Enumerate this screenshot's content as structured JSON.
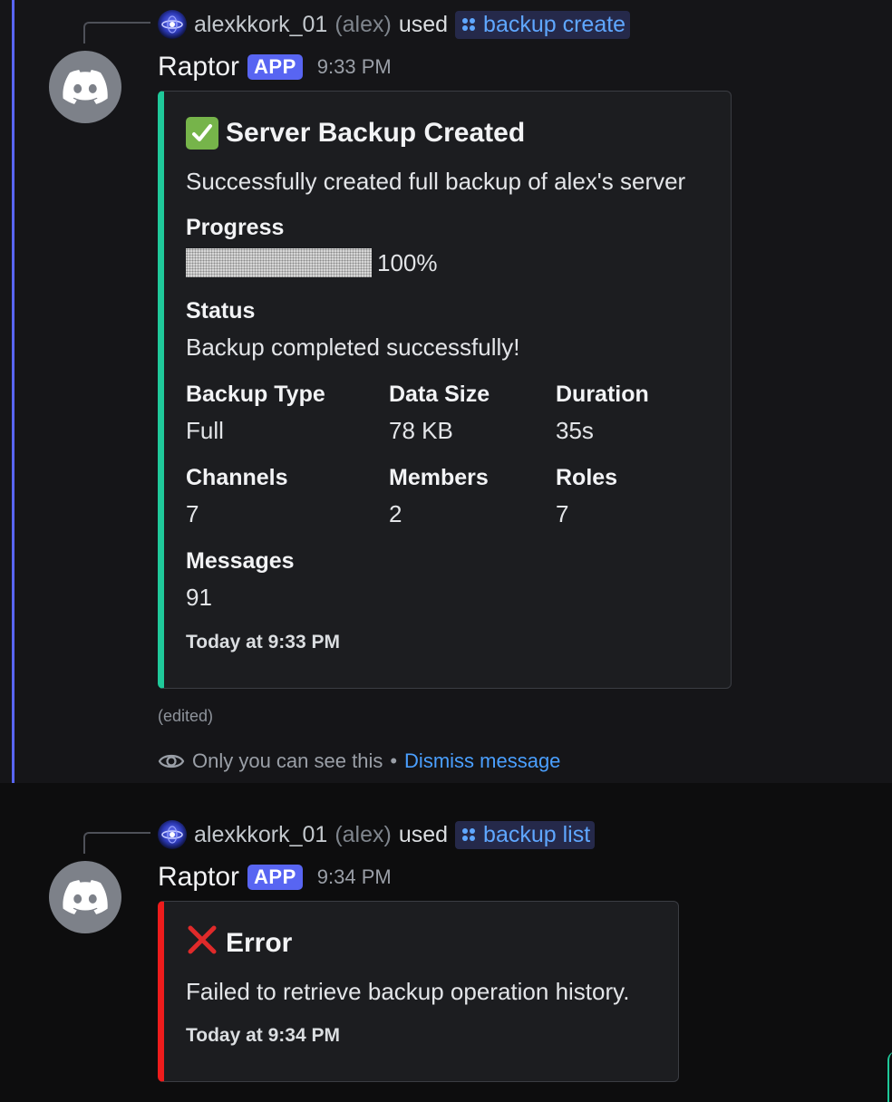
{
  "messages": [
    {
      "reply": {
        "user": "alexkkork_01",
        "nick": "(alex)",
        "used": "used",
        "command": "backup create"
      },
      "bot": {
        "name": "Raptor",
        "badge": "APP",
        "time": "9:33 PM"
      },
      "embed": {
        "accent": "#1fc99a",
        "icon": "check-mark-icon",
        "title": "Server Backup Created",
        "description": "Successfully created full backup of alex's server",
        "progress": {
          "label": "Progress",
          "percent": 100,
          "text": "100%"
        },
        "status": {
          "label": "Status",
          "value": "Backup completed successfully!"
        },
        "fields": [
          {
            "name": "Backup Type",
            "value": "Full"
          },
          {
            "name": "Data Size",
            "value": "78 KB"
          },
          {
            "name": "Duration",
            "value": "35s"
          },
          {
            "name": "Channels",
            "value": "7"
          },
          {
            "name": "Members",
            "value": "2"
          },
          {
            "name": "Roles",
            "value": "7"
          },
          {
            "name": "Messages",
            "value": "91"
          }
        ],
        "footer": "Today at 9:33 PM"
      },
      "edited": "(edited)",
      "ephemeral": {
        "notice": "Only you can see this",
        "separator": "•",
        "dismiss": "Dismiss message"
      }
    },
    {
      "reply": {
        "user": "alexkkork_01",
        "nick": "(alex)",
        "used": "used",
        "command": "backup list"
      },
      "bot": {
        "name": "Raptor",
        "badge": "APP",
        "time": "9:34 PM"
      },
      "embed": {
        "accent": "#ee1c1c",
        "icon": "cross-mark-icon",
        "title": "Error",
        "description": "Failed to retrieve backup operation history.",
        "footer": "Today at 9:34 PM"
      }
    }
  ],
  "colors": {
    "blurple": "#5865f2",
    "link": "#4a9fff",
    "success": "#1fc99a",
    "error": "#ee1c1c"
  }
}
